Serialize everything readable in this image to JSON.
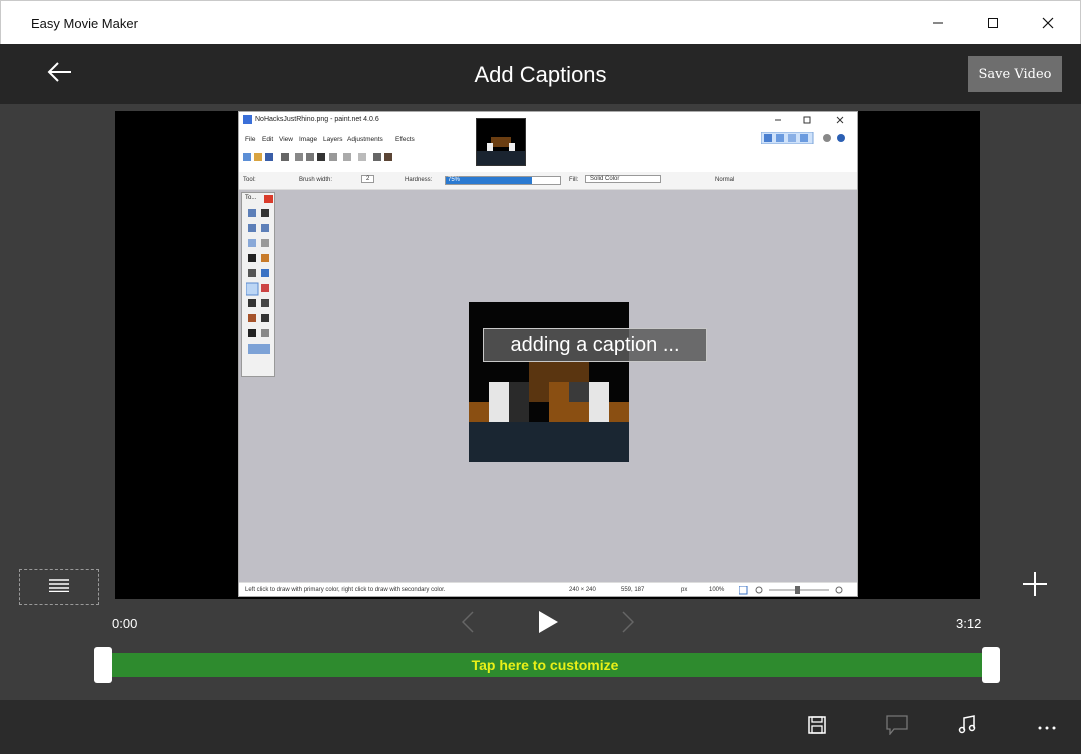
{
  "window": {
    "app_title": "Easy Movie Maker",
    "controls": [
      "minimize-icon",
      "maximize-icon",
      "close-icon"
    ]
  },
  "header": {
    "back_icon": "arrow-left-icon",
    "title": "Add Captions",
    "save_label": "Save Video"
  },
  "video": {
    "caption_text": "adding a caption ...",
    "embedded_app": {
      "title": "NoHacksJustRhino.png - paint.net 4.0.6",
      "menus": [
        "File",
        "Edit",
        "View",
        "Image",
        "Layers",
        "Adjustments",
        "Effects"
      ],
      "toolbar": {
        "tool_label": "Tool:",
        "brush_width_label": "Brush width:",
        "brush_width_value": "2",
        "hardness_label": "Hardness:",
        "hardness_value": "75%",
        "hardness_fraction": 0.75,
        "fill_label": "Fill:",
        "fill_value": "Solid Color",
        "blend_value": "Normal"
      },
      "tools_title": "To...",
      "status": {
        "hint": "Left click to draw with primary color, right click to draw with secondary color.",
        "size": "240 × 240",
        "cursor": "559, 187",
        "units": "px",
        "zoom": "100%"
      }
    }
  },
  "playback": {
    "time_start": "0:00",
    "time_end": "3:12",
    "prev_icon": "chevron-left-icon",
    "play_icon": "play-icon",
    "next_icon": "chevron-right-icon"
  },
  "timeline": {
    "label": "Tap here to customize",
    "color": "#2e8b2e",
    "label_color": "#e8f018"
  },
  "side": {
    "list_icon": "list-icon",
    "add_icon": "plus-icon"
  },
  "appbar": {
    "icons": [
      "save-icon",
      "caption-icon",
      "music-icon",
      "more-icon"
    ]
  }
}
